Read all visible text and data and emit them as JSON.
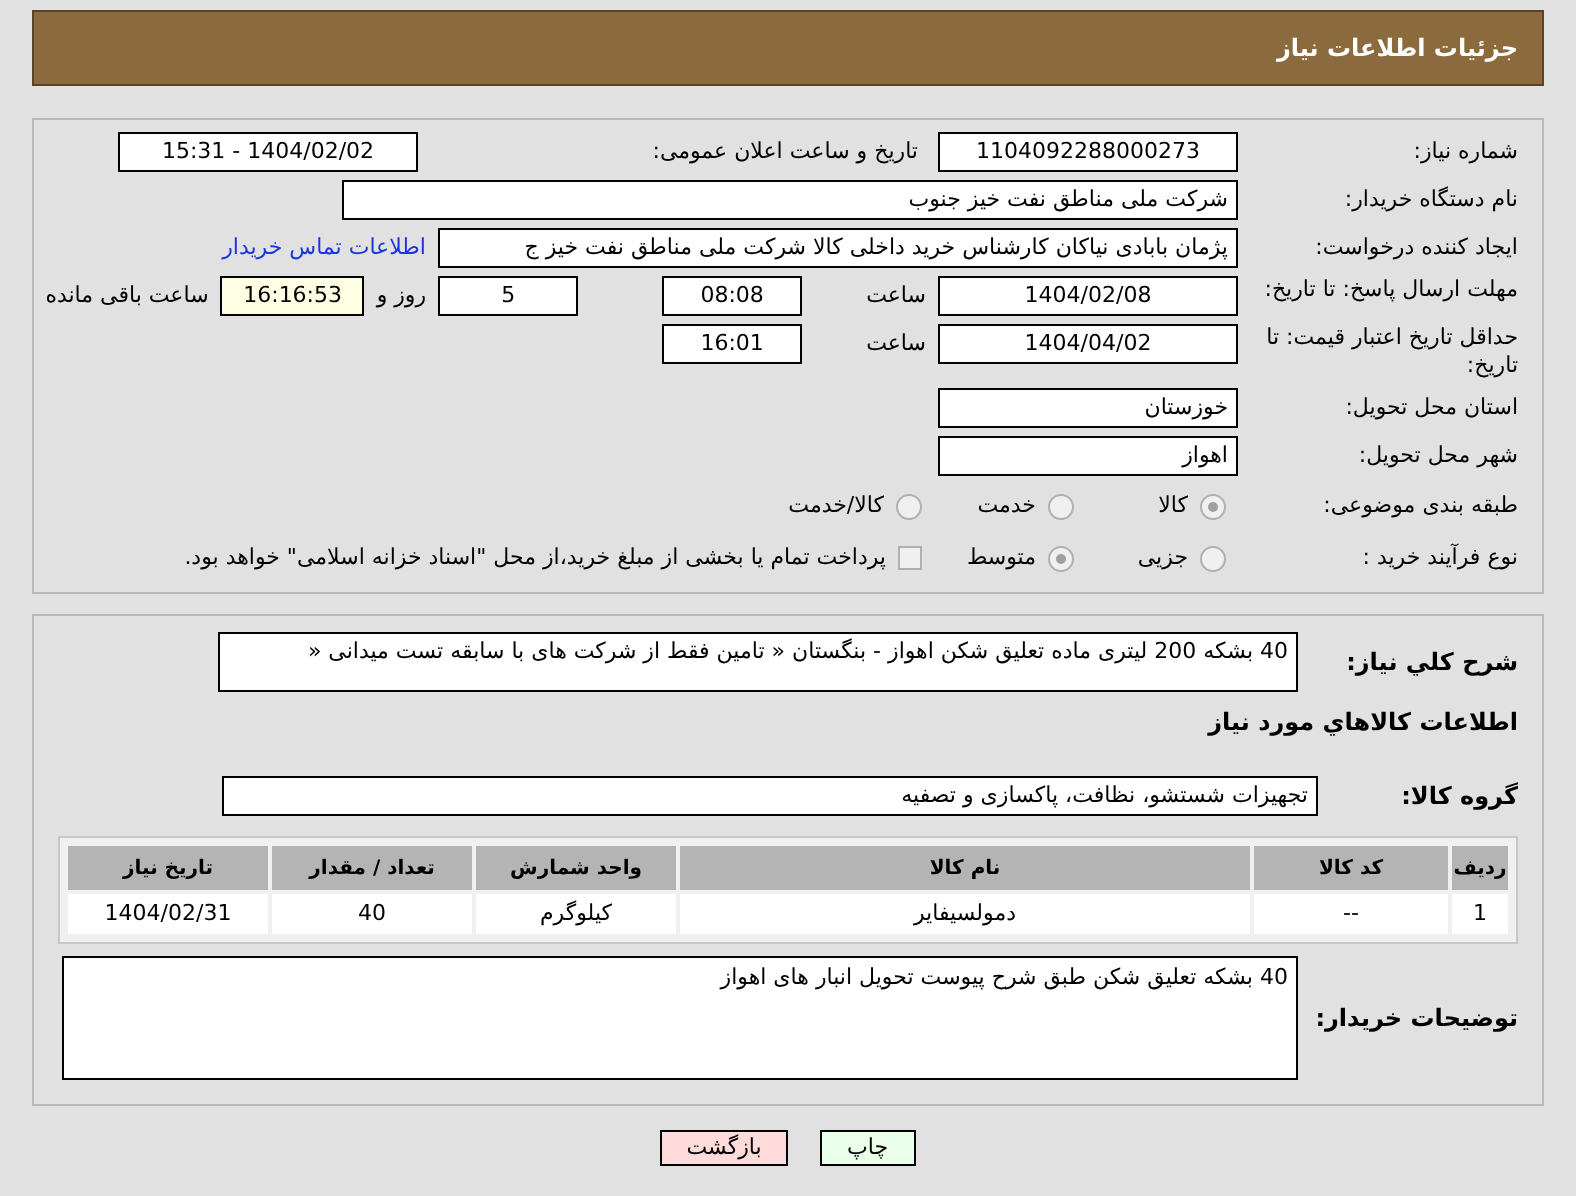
{
  "header": {
    "title": "جزئیات اطلاعات نیاز"
  },
  "need_number": {
    "label": "شماره نیاز:",
    "value": "1104092288000273"
  },
  "announce": {
    "label": "تاریخ و ساعت اعلان عمومی:",
    "value": "1404/02/02 - 15:31"
  },
  "buyer": {
    "label": "نام دستگاه خریدار:",
    "value": "شرکت ملی مناطق نفت خیز جنوب"
  },
  "creator": {
    "label": "ایجاد کننده درخواست:",
    "value": "پژمان  بابادی نیاکان  کارشناس خرید داخلی کالا  شرکت ملی مناطق نفت خیز ج",
    "link": "اطلاعات تماس خریدار"
  },
  "deadline": {
    "label": "مهلت ارسال پاسخ: تا تاریخ:",
    "date": "1404/02/08",
    "time_label": "ساعت",
    "time": "08:08",
    "days": "5",
    "days_label": "روز و",
    "remaining": "16:16:53",
    "remaining_label": "ساعت باقی مانده"
  },
  "validity": {
    "label": "حداقل تاریخ اعتبار قیمت: تا تاریخ:",
    "date": "1404/04/02",
    "time_label": "ساعت",
    "time": "16:01"
  },
  "province": {
    "label": "استان محل تحویل:",
    "value": "خوزستان"
  },
  "city": {
    "label": "شهر محل تحویل:",
    "value": "اهواز"
  },
  "category": {
    "label": "طبقه بندی موضوعی:",
    "options": [
      {
        "label": "کالا",
        "selected": true
      },
      {
        "label": "خدمت",
        "selected": false
      },
      {
        "label": "کالا/خدمت",
        "selected": false
      }
    ]
  },
  "process": {
    "label": "نوع فرآیند خرید :",
    "options": [
      {
        "label": "جزیی",
        "selected": false
      },
      {
        "label": "متوسط",
        "selected": true
      }
    ],
    "payment": {
      "label": "پرداخت تمام یا بخشی از مبلغ خرید،از محل \"اسناد خزانه اسلامی\" خواهد بود.",
      "checked": false
    }
  },
  "summary": {
    "label": "شرح کلي نياز:",
    "value": "40 بشکه  200 لیتری ماده تعلیق شکن  اهواز - بنگستان « تامین فقط از شرکت های با سابقه تست میدانی «"
  },
  "goods_heading": "اطلاعات کالاهاي مورد نياز",
  "goods_group": {
    "label": "گروه کالا:",
    "value": "تجهیزات شستشو، نظافت، پاکسازی و تصفیه"
  },
  "table": {
    "columns": [
      "ردیف",
      "کد کالا",
      "نام کالا",
      "واحد شمارش",
      "تعداد / مقدار",
      "تاریخ نیاز"
    ],
    "rows": [
      [
        "1",
        "--",
        "دمولسیفایر",
        "کیلوگرم",
        "40",
        "1404/02/31"
      ]
    ]
  },
  "notes": {
    "label": "توضیحات خریدار:",
    "value": "40 بشکه تعلیق شکن طبق شرح پیوست   تحویل انبار های اهواز"
  },
  "buttons": [
    {
      "kind": "print",
      "label": "چاپ"
    },
    {
      "kind": "back",
      "label": "بازگشت"
    }
  ]
}
